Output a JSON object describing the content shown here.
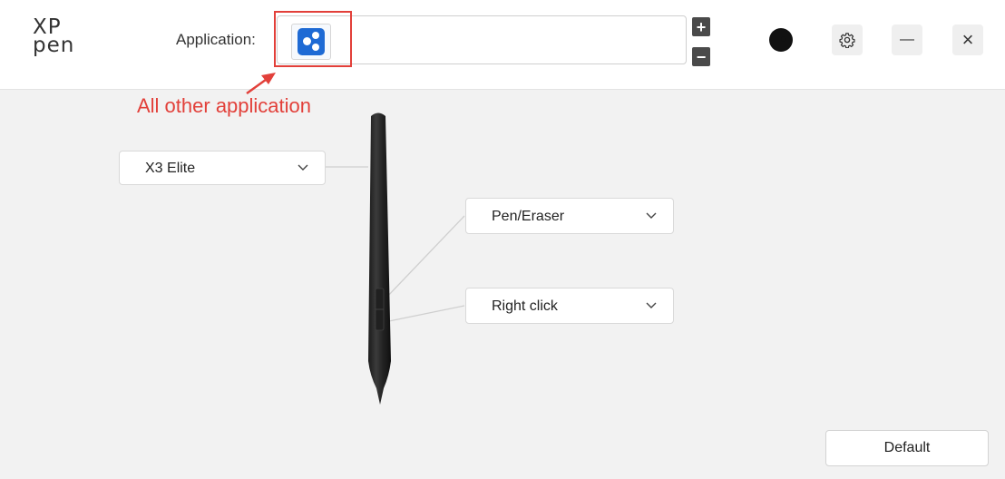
{
  "header": {
    "logo_line1": "XP",
    "logo_line2": "pen",
    "application_label": "Application:",
    "add_label": "+",
    "remove_label": "−",
    "settings_icon": "gear-icon",
    "minimize_label": "—",
    "close_label": "×"
  },
  "annotation": {
    "text": "All other application",
    "color": "#e2403a"
  },
  "pen": {
    "model_select": "X3 Elite",
    "upper_button_select": "Pen/Eraser",
    "lower_button_select": "Right click"
  },
  "footer": {
    "default_label": "Default"
  },
  "colors": {
    "accent_blue": "#1e6ad4",
    "highlight_red": "#e2403a"
  }
}
